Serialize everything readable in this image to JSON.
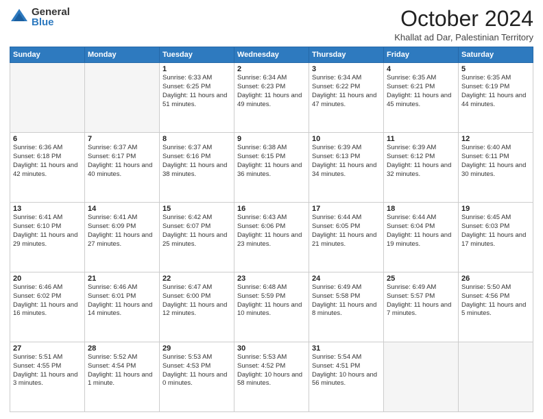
{
  "logo": {
    "general": "General",
    "blue": "Blue"
  },
  "title": "October 2024",
  "location": "Khallat ad Dar, Palestinian Territory",
  "days_of_week": [
    "Sunday",
    "Monday",
    "Tuesday",
    "Wednesday",
    "Thursday",
    "Friday",
    "Saturday"
  ],
  "weeks": [
    [
      {
        "day": "",
        "info": ""
      },
      {
        "day": "",
        "info": ""
      },
      {
        "day": "1",
        "info": "Sunrise: 6:33 AM\nSunset: 6:25 PM\nDaylight: 11 hours and 51 minutes."
      },
      {
        "day": "2",
        "info": "Sunrise: 6:34 AM\nSunset: 6:23 PM\nDaylight: 11 hours and 49 minutes."
      },
      {
        "day": "3",
        "info": "Sunrise: 6:34 AM\nSunset: 6:22 PM\nDaylight: 11 hours and 47 minutes."
      },
      {
        "day": "4",
        "info": "Sunrise: 6:35 AM\nSunset: 6:21 PM\nDaylight: 11 hours and 45 minutes."
      },
      {
        "day": "5",
        "info": "Sunrise: 6:35 AM\nSunset: 6:19 PM\nDaylight: 11 hours and 44 minutes."
      }
    ],
    [
      {
        "day": "6",
        "info": "Sunrise: 6:36 AM\nSunset: 6:18 PM\nDaylight: 11 hours and 42 minutes."
      },
      {
        "day": "7",
        "info": "Sunrise: 6:37 AM\nSunset: 6:17 PM\nDaylight: 11 hours and 40 minutes."
      },
      {
        "day": "8",
        "info": "Sunrise: 6:37 AM\nSunset: 6:16 PM\nDaylight: 11 hours and 38 minutes."
      },
      {
        "day": "9",
        "info": "Sunrise: 6:38 AM\nSunset: 6:15 PM\nDaylight: 11 hours and 36 minutes."
      },
      {
        "day": "10",
        "info": "Sunrise: 6:39 AM\nSunset: 6:13 PM\nDaylight: 11 hours and 34 minutes."
      },
      {
        "day": "11",
        "info": "Sunrise: 6:39 AM\nSunset: 6:12 PM\nDaylight: 11 hours and 32 minutes."
      },
      {
        "day": "12",
        "info": "Sunrise: 6:40 AM\nSunset: 6:11 PM\nDaylight: 11 hours and 30 minutes."
      }
    ],
    [
      {
        "day": "13",
        "info": "Sunrise: 6:41 AM\nSunset: 6:10 PM\nDaylight: 11 hours and 29 minutes."
      },
      {
        "day": "14",
        "info": "Sunrise: 6:41 AM\nSunset: 6:09 PM\nDaylight: 11 hours and 27 minutes."
      },
      {
        "day": "15",
        "info": "Sunrise: 6:42 AM\nSunset: 6:07 PM\nDaylight: 11 hours and 25 minutes."
      },
      {
        "day": "16",
        "info": "Sunrise: 6:43 AM\nSunset: 6:06 PM\nDaylight: 11 hours and 23 minutes."
      },
      {
        "day": "17",
        "info": "Sunrise: 6:44 AM\nSunset: 6:05 PM\nDaylight: 11 hours and 21 minutes."
      },
      {
        "day": "18",
        "info": "Sunrise: 6:44 AM\nSunset: 6:04 PM\nDaylight: 11 hours and 19 minutes."
      },
      {
        "day": "19",
        "info": "Sunrise: 6:45 AM\nSunset: 6:03 PM\nDaylight: 11 hours and 17 minutes."
      }
    ],
    [
      {
        "day": "20",
        "info": "Sunrise: 6:46 AM\nSunset: 6:02 PM\nDaylight: 11 hours and 16 minutes."
      },
      {
        "day": "21",
        "info": "Sunrise: 6:46 AM\nSunset: 6:01 PM\nDaylight: 11 hours and 14 minutes."
      },
      {
        "day": "22",
        "info": "Sunrise: 6:47 AM\nSunset: 6:00 PM\nDaylight: 11 hours and 12 minutes."
      },
      {
        "day": "23",
        "info": "Sunrise: 6:48 AM\nSunset: 5:59 PM\nDaylight: 11 hours and 10 minutes."
      },
      {
        "day": "24",
        "info": "Sunrise: 6:49 AM\nSunset: 5:58 PM\nDaylight: 11 hours and 8 minutes."
      },
      {
        "day": "25",
        "info": "Sunrise: 6:49 AM\nSunset: 5:57 PM\nDaylight: 11 hours and 7 minutes."
      },
      {
        "day": "26",
        "info": "Sunrise: 5:50 AM\nSunset: 4:56 PM\nDaylight: 11 hours and 5 minutes."
      }
    ],
    [
      {
        "day": "27",
        "info": "Sunrise: 5:51 AM\nSunset: 4:55 PM\nDaylight: 11 hours and 3 minutes."
      },
      {
        "day": "28",
        "info": "Sunrise: 5:52 AM\nSunset: 4:54 PM\nDaylight: 11 hours and 1 minute."
      },
      {
        "day": "29",
        "info": "Sunrise: 5:53 AM\nSunset: 4:53 PM\nDaylight: 11 hours and 0 minutes."
      },
      {
        "day": "30",
        "info": "Sunrise: 5:53 AM\nSunset: 4:52 PM\nDaylight: 10 hours and 58 minutes."
      },
      {
        "day": "31",
        "info": "Sunrise: 5:54 AM\nSunset: 4:51 PM\nDaylight: 10 hours and 56 minutes."
      },
      {
        "day": "",
        "info": ""
      },
      {
        "day": "",
        "info": ""
      }
    ]
  ]
}
